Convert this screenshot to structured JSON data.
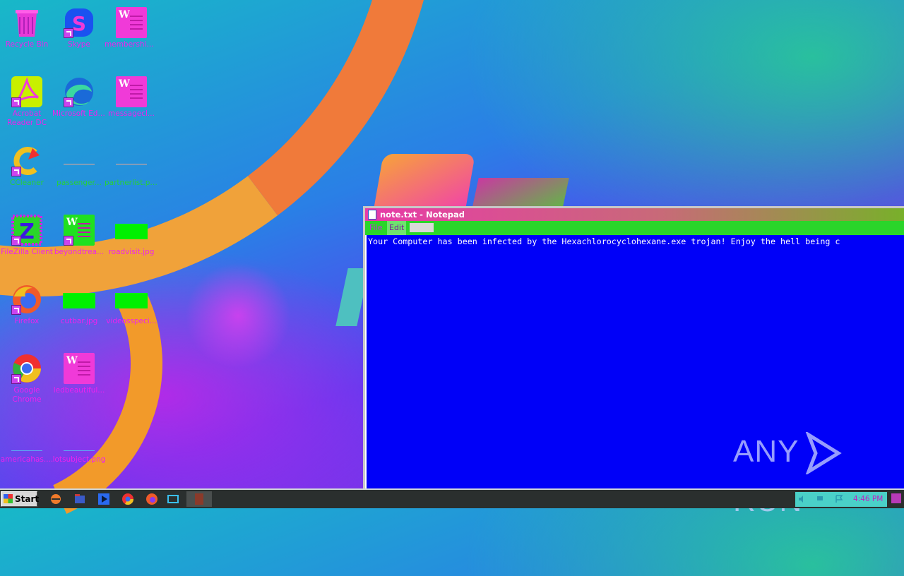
{
  "desktop": {
    "icons": [
      {
        "label": "Recycle Bin",
        "kind": "recycle-bin-icon"
      },
      {
        "label": "Skype",
        "kind": "skype-icon"
      },
      {
        "label": "membership...",
        "kind": "word-document-icon"
      },
      {
        "label": "Acrobat Reader DC",
        "kind": "acrobat-icon"
      },
      {
        "label": "Microsoft Edge",
        "kind": "edge-icon"
      },
      {
        "label": "messagecl...",
        "kind": "word-document-icon"
      },
      {
        "label": "CCleaner",
        "kind": "ccleaner-icon"
      },
      {
        "label": "passenger...",
        "kind": "image-file-icon"
      },
      {
        "label": "partnerlist.png",
        "kind": "image-file-icon"
      },
      {
        "label": "FileZilla Client",
        "kind": "filezilla-icon"
      },
      {
        "label": "beyondtrea...",
        "kind": "word-document-icon"
      },
      {
        "label": "roadvisit.jpg",
        "kind": "image-file-icon"
      },
      {
        "label": "Firefox",
        "kind": "firefox-icon"
      },
      {
        "label": "cutbar.jpg",
        "kind": "image-file-icon"
      },
      {
        "label": "videosspeci...",
        "kind": "image-file-icon"
      },
      {
        "label": "Google Chrome",
        "kind": "chrome-icon"
      },
      {
        "label": "ledbeautiful...",
        "kind": "word-document-icon"
      },
      {
        "label": "americahas....",
        "kind": "file-icon"
      },
      {
        "label": "lotsubject.png",
        "kind": "image-file-icon"
      }
    ]
  },
  "notepad": {
    "title": "note.txt - Notepad",
    "menu": [
      "File",
      "Edit"
    ],
    "content": "Your Computer has been infected by the Hexachlorocyclohexane.exe trojan! Enjoy the hell being c"
  },
  "watermark": {
    "left": "ANY",
    "right": "RUN"
  },
  "taskbar": {
    "start_label": "Start",
    "clock": "4:46 PM",
    "quicklaunch": [
      "ie-icon",
      "explorer-icon",
      "media-player-icon",
      "chrome-icon",
      "firefox-icon",
      "show-desktop-icon",
      "notepad-task-icon"
    ]
  }
}
